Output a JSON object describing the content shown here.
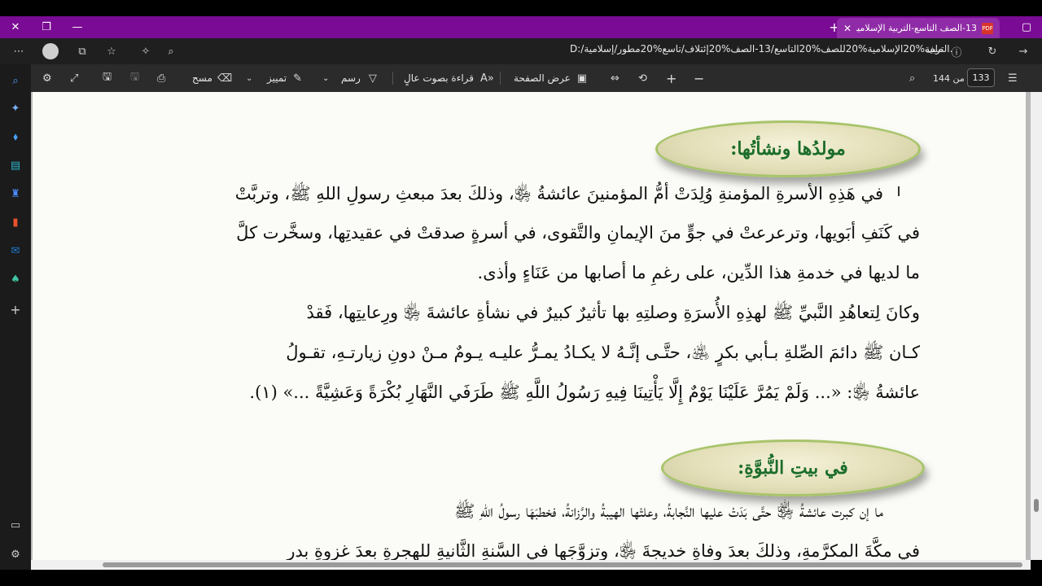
{
  "browser": {
    "tab_title": "13-الصف التاسع-التربية الإسلامية.pdf",
    "file_label": "ملف",
    "url": "D:/التربية%20الإسلامية%20للصف%20التاسع/13-الصف%20إئتلاف/تاسع%20مطور/إسلامية.pdf"
  },
  "pdf_toolbar": {
    "page_current": "133",
    "page_of": "من 144",
    "page_view_label": "عرض الصفحة",
    "read_aloud_label": "قراءة بصوت عالٍ",
    "draw_label": "رسم",
    "highlight_label": "تمييز",
    "erase_label": "مسح"
  },
  "document": {
    "heading1": "مولدُها ونشأتُها:",
    "para1": [
      "في هَذِهِ الأسرةِ المؤمنةِ وُلِدَتْ أمُّ المؤمنينَ عائشةُ ﵂، وذلكَ بعدَ مبعثِ رسولِ اللهِ ﷺ، وتربَّتْ",
      "في كَنَفِ أبَويها، وترعرعتْ في جوٍّ منَ الإيمانِ والتَّقوى، في أسرةٍ صدقتْ في عقيدتِها، وسخَّرت كلَّ",
      "ما لديها في خدمةِ هذا الدِّين، على رغمِ ما أصابها من عَنَاءٍ وأذى."
    ],
    "para2": [
      "وكانَ لِتعاهُدِ النَّبيِّ ﷺ لهذِهِ الأُسرَةِ وصلتِهِ بها تأثيرٌ كبيرٌ في نشأةِ عائشةَ ﵂ ورِعايتِها، فَقدْ",
      "كـان ﷺ دائمَ الصِّلةِ بـأبي بكرٍ ﵁، حتَّـى إنَّـهُ لا يكـادُ يمـرُّ عليـه يـومٌ مـنْ دونِ زيارتـهِ، تقـولُ",
      "عائشةُ ﵂: «... وَلَمْ يَمُرَّ عَلَيْنَا يَوْمٌ إِلَّا يَأْتِينَا فِيهِ رَسُولُ اللَّهِ ﷺ طَرَفَي النَّهَارِ بُكْرَةً وَعَشِيَّةً ...» (١)."
    ],
    "heading2": "في بيتِ النُّبوَّةِ:",
    "para3": [
      "ما إن كبرت عائشةُ ﵂ حتَّى بَدَتْ عليها النَّجابةُ، وعلتْها الهيبةُ والرَّزانةُ، فخطبَهَا رسولُ اللهِ ﷺ",
      "في مكَّةَ المكرَّمةِ، وذلكَ بعدَ وفاةِ خديجةَ ﵂، وتزوَّجَها في السَّنةِ الثَّانيةِ للهجرةِ بعدَ غزوةِ بدرٍ"
    ]
  }
}
